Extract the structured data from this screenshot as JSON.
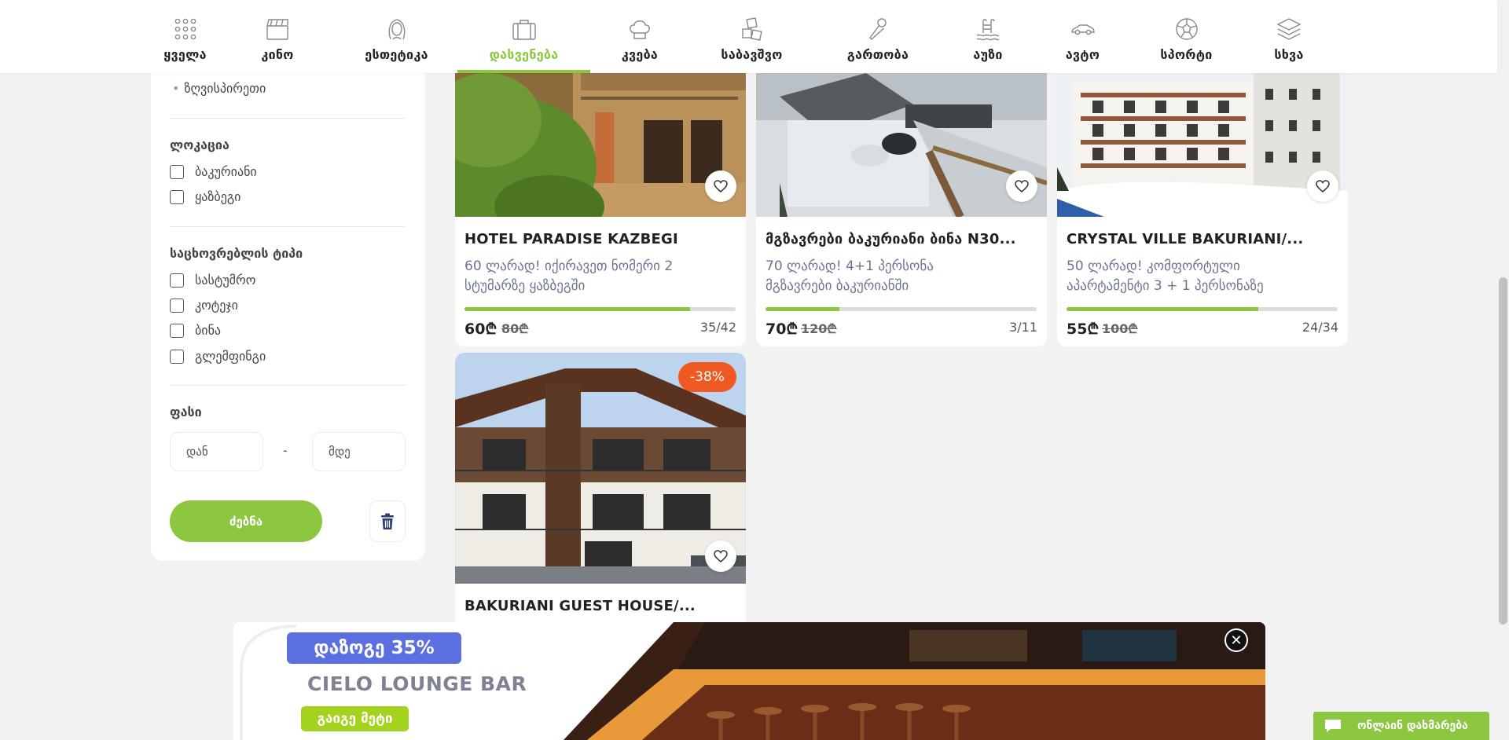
{
  "nav": {
    "items": [
      {
        "label": "ყველა",
        "icon": "grid-icon"
      },
      {
        "label": "კინო",
        "icon": "clapperboard-icon"
      },
      {
        "label": "ესთეტიკა",
        "icon": "woman-face-icon"
      },
      {
        "label": "დასვენება",
        "icon": "suitcase-icon",
        "active": true
      },
      {
        "label": "კვება",
        "icon": "chef-hat-icon"
      },
      {
        "label": "საბავშვო",
        "icon": "toy-blocks-icon"
      },
      {
        "label": "გართობა",
        "icon": "microphone-icon"
      },
      {
        "label": "აუზი",
        "icon": "pool-ladder-icon"
      },
      {
        "label": "ავტო",
        "icon": "car-icon"
      },
      {
        "label": "სპორტი",
        "icon": "soccer-ball-icon"
      },
      {
        "label": "სხვა",
        "icon": "layers-icon"
      }
    ],
    "accent": "#8dc63f"
  },
  "sidebar": {
    "sub_item": "ზღვისპირეთი",
    "location_heading": "ლოკაცია",
    "locations": [
      "ბაკურიანი",
      "ყაზბეგი"
    ],
    "type_heading": "საცხოვრებლის ტიპი",
    "types": [
      "სასტუმრო",
      "კოტეჯი",
      "ბინა",
      "გლემფინგი"
    ],
    "price_heading": "ფასი",
    "price_from_placeholder": "დან",
    "price_dash": "-",
    "price_to_placeholder": "მდე",
    "search_label": "ძებნა"
  },
  "cards": [
    {
      "title": "HOTEL PARADISE KAZBEGI",
      "desc": "60 ლარად! იქირავეთ ნომერი 2 სტუმარზე ყაზბეგში",
      "price": "60₾",
      "old_price": "80₾",
      "sold": "35/42",
      "progress": 0.833
    },
    {
      "title": "მგზავრები ბაკურიანი ბინა N30...",
      "desc": "70 ლარად! 4+1 პერსონა მგზავრები ბაკურიანში",
      "price": "70₾",
      "old_price": "120₾",
      "sold": "3/11",
      "progress": 0.273
    },
    {
      "title": "CRYSTAL VILLE BAKURIANI/...",
      "desc": "50 ლარად! კომფორტული აპარტამენტი 3 + 1 პერსონაზე",
      "price": "55₾",
      "old_price": "100₾",
      "sold": "24/34",
      "progress": 0.706
    },
    {
      "title": "BAKURIANI GUEST HOUSE/...",
      "badge": "-38%"
    }
  ],
  "banner": {
    "tag": "დაზოგე 35%",
    "title": "CIELO LOUNGE BAR",
    "cta": "გაიგე მეტი",
    "close": "✕"
  },
  "chat": {
    "label": "ონლაინ დახმარება"
  }
}
